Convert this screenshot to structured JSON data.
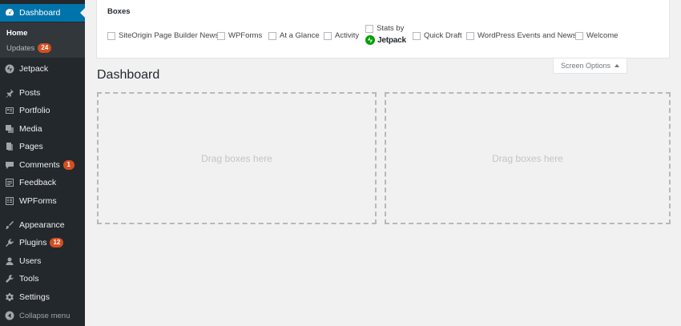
{
  "sidebar": {
    "dashboard": "Dashboard",
    "submenu": {
      "home": "Home",
      "updates": "Updates",
      "updates_count": "24"
    },
    "items": [
      {
        "label": "Jetpack",
        "icon": "jetpack-icon"
      },
      {
        "label": "Posts",
        "icon": "pin-icon"
      },
      {
        "label": "Portfolio",
        "icon": "portfolio-icon"
      },
      {
        "label": "Media",
        "icon": "media-icon"
      },
      {
        "label": "Pages",
        "icon": "pages-icon"
      },
      {
        "label": "Comments",
        "icon": "comment-icon",
        "badge": "1"
      },
      {
        "label": "Feedback",
        "icon": "feedback-icon"
      },
      {
        "label": "WPForms",
        "icon": "forms-icon"
      },
      {
        "label": "Appearance",
        "icon": "brush-icon"
      },
      {
        "label": "Plugins",
        "icon": "plug-icon",
        "badge": "12"
      },
      {
        "label": "Users",
        "icon": "user-icon"
      },
      {
        "label": "Tools",
        "icon": "wrench-icon"
      },
      {
        "label": "Settings",
        "icon": "settings-icon"
      }
    ],
    "collapse": "Collapse menu"
  },
  "screen_options": {
    "boxes_title": "Boxes",
    "options": [
      "SiteOrigin Page Builder News",
      "WPForms",
      "At a Glance",
      "Activity",
      "Stats by",
      "Quick Draft",
      "WordPress Events and News",
      "Welcome"
    ],
    "jetpack_word": "Jetpack",
    "tab_label": "Screen Options"
  },
  "main": {
    "title": "Dashboard",
    "dropzone_left": "Drag boxes here",
    "dropzone_right": "Drag boxes here"
  },
  "colors": {
    "sidebar_bg": "#23282d",
    "accent": "#0073aa",
    "badge": "#d54e21",
    "jetpack_green": "#069e08"
  }
}
